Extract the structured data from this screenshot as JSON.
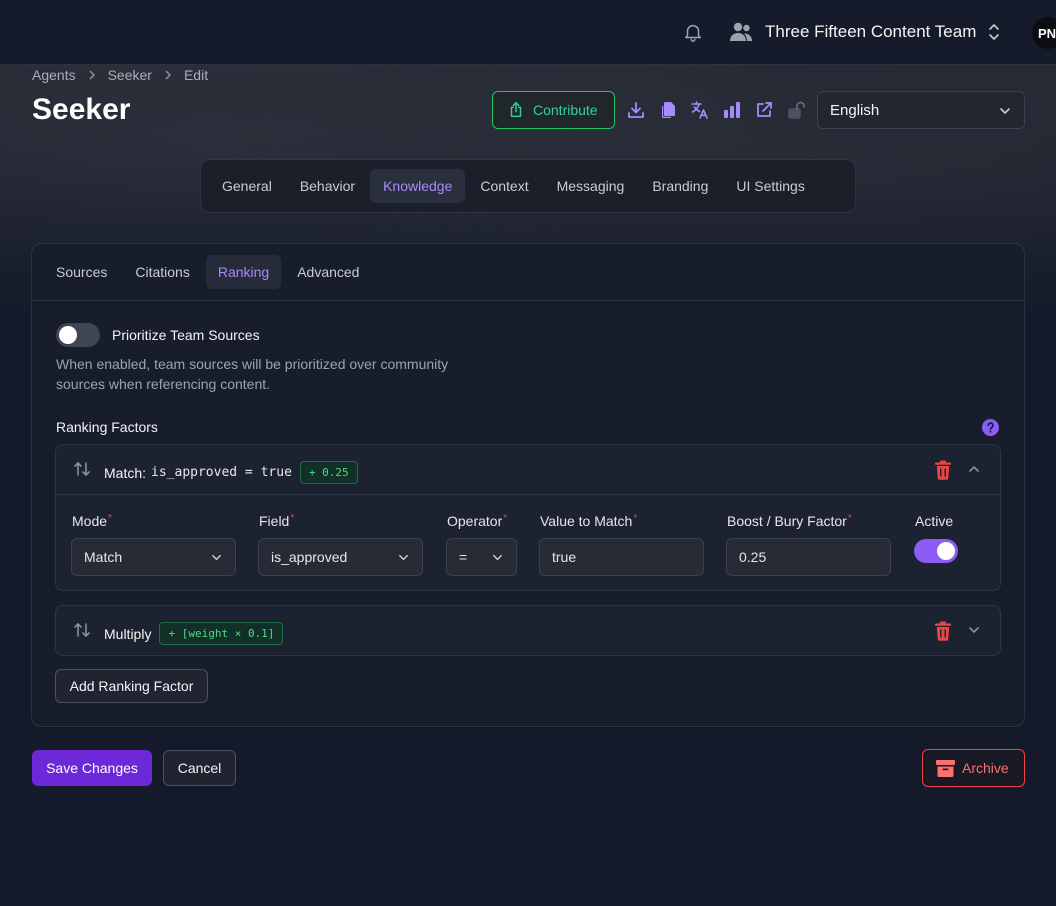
{
  "topbar": {
    "team_name": "Three Fifteen Content Team",
    "avatar_initials": "PN"
  },
  "breadcrumb": [
    "Agents",
    "Seeker",
    "Edit"
  ],
  "page_title": "Seeker",
  "header": {
    "contribute_label": "Contribute",
    "language": "English",
    "accent_color": "#a78bfa",
    "contribute_color": "#22c55e"
  },
  "main_tabs": [
    "General",
    "Behavior",
    "Knowledge",
    "Context",
    "Messaging",
    "Branding",
    "UI Settings"
  ],
  "main_tab_active": "Knowledge",
  "sub_tabs": [
    "Sources",
    "Citations",
    "Ranking",
    "Advanced"
  ],
  "sub_tab_active": "Ranking",
  "prioritize": {
    "label": "Prioritize Team Sources",
    "description": "When enabled, team sources will be prioritized over community sources when referencing content.",
    "enabled": false
  },
  "ranking_factors": {
    "label": "Ranking Factors",
    "factors": [
      {
        "title": "Match:",
        "expression": "is_approved = true",
        "badge": "+ 0.25",
        "expanded": true,
        "fields": {
          "mode_label": "Mode",
          "mode_value": "Match",
          "field_label": "Field",
          "field_value": "is_approved",
          "operator_label": "Operator",
          "operator_value": "=",
          "value_label": "Value to Match",
          "value_value": "true",
          "boost_label": "Boost / Bury Factor",
          "boost_value": "0.25",
          "active_label": "Active",
          "active": true
        }
      },
      {
        "title": "Multiply",
        "expression": "",
        "badge": "+ [weight × 0.1]",
        "expanded": false
      }
    ],
    "add_label": "Add Ranking Factor"
  },
  "footer": {
    "save_label": "Save Changes",
    "cancel_label": "Cancel",
    "archive_label": "Archive",
    "save_color": "#6d28d9",
    "archive_color": "#ef4444"
  }
}
